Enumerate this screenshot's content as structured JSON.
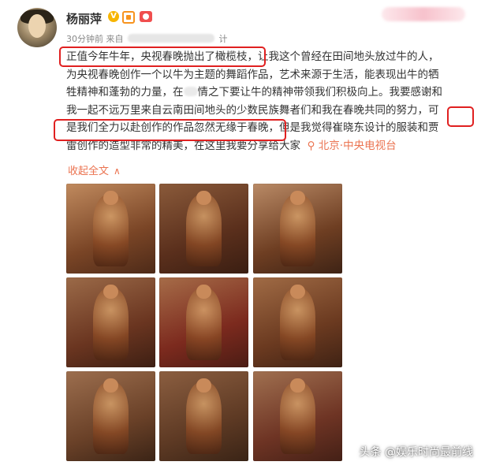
{
  "author": {
    "name": "杨丽萍",
    "verified_badge": "V"
  },
  "meta": {
    "time": "30分钟前",
    "source_prefix": "来自",
    "source_suffix": "计"
  },
  "post": {
    "line1": "正值今年牛年，央视春晚抛出了橄榄枝，让我这个曾经在田间地头放过牛的人，",
    "line2": "为央视春晚创作一个以牛为主题的舞蹈作品，艺术来源于生活，能表现出牛的牺",
    "line3": "牲精神和蓬勃的力量，在",
    "line3_after": "情之下要让牛的精神带领我们积极向上。我要感谢和",
    "line4": "我一起不远万里来自云南田间地头的少数民族舞者们和我在春晚共同的努力，可",
    "line5": "是我们全力以赴创作的作品忽然无缘于春晚，但是我觉得崔晓东设计的服装和贾",
    "line6": "雷创作的造型非常的精美，在这里我要分享给大家",
    "location": "北京·中央电视台"
  },
  "collapse_label": "收起全文",
  "photos": [
    {
      "name": "photo-1"
    },
    {
      "name": "photo-2"
    },
    {
      "name": "photo-3"
    },
    {
      "name": "photo-4"
    },
    {
      "name": "photo-5"
    },
    {
      "name": "photo-6"
    },
    {
      "name": "photo-7"
    },
    {
      "name": "photo-8"
    },
    {
      "name": "photo-9"
    }
  ],
  "watermark": "头条 @娱乐时尚最前线",
  "colors": {
    "highlight": "#e02020",
    "link": "#eb7350",
    "badge": "#f7b500"
  }
}
